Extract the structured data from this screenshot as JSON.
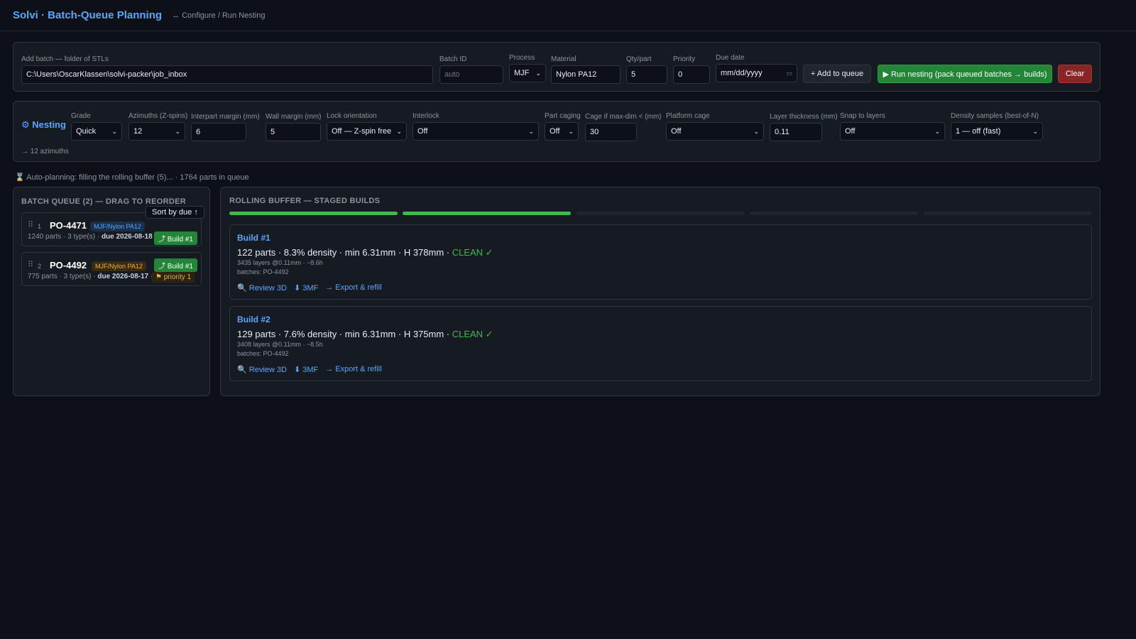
{
  "header": {
    "title": "Solvi · Batch-Queue Planning",
    "breadcrumb": "↔ Configure / Run Nesting"
  },
  "add_batch": {
    "folder_label": "Add batch — folder of STLs",
    "folder_value": "C:\\Users\\OscarKlassen\\solvi-packer\\job_inbox",
    "batch_id_label": "Batch ID",
    "batch_id_placeholder": "auto",
    "process_label": "Process",
    "process_value": "MJF",
    "material_label": "Material",
    "material_value": "Nylon PA12",
    "qty_label": "Qty/part",
    "qty_value": "5",
    "priority_label": "Priority",
    "priority_value": "0",
    "due_label": "Due date",
    "due_placeholder": "mm/dd/yyyy",
    "add_button": "+ Add to queue",
    "run_button": "▶ Run nesting (pack queued batches → builds)",
    "clear_button": "Clear"
  },
  "nesting": {
    "title": "⚙ Nesting",
    "azimuth_note": "→ 12 azimuths",
    "grade": {
      "label": "Grade",
      "value": "Quick"
    },
    "azimuths": {
      "label": "Azimuths (Z-spins)",
      "value": "12"
    },
    "interpart": {
      "label": "Interpart margin (mm)",
      "value": "6"
    },
    "wall": {
      "label": "Wall margin (mm)",
      "value": "5"
    },
    "lock": {
      "label": "Lock orientation",
      "value": "Off — Z-spin free"
    },
    "interlock": {
      "label": "Interlock",
      "value": "Off"
    },
    "caging": {
      "label": "Part caging",
      "value": "Off"
    },
    "cage_if": {
      "label": "Cage if max-dim < (mm)",
      "value": "30"
    },
    "platform": {
      "label": "Platform cage",
      "value": "Off"
    },
    "layer": {
      "label": "Layer thickness (mm)",
      "value": "0.11"
    },
    "snap": {
      "label": "Snap to layers",
      "value": "Off"
    },
    "density": {
      "label": "Density samples (best-of-N)",
      "value": "1 — off (fast)"
    }
  },
  "status": "⌛ Auto-planning: filling the rolling buffer (5)... · 1764 parts in queue",
  "queue": {
    "title": "BATCH QUEUE (2) — DRAG TO REORDER",
    "sort_button": "Sort by due ↑",
    "items": [
      {
        "num": "1",
        "id": "PO-4471",
        "tag": "MJF/Nylon PA12",
        "meta_prefix": "1240 parts · 3 type(s) · ",
        "due": "due 2026-08-18",
        "build": "⤴ Build #1"
      },
      {
        "num": "2",
        "id": "PO-4492",
        "tag": "MJF/Nylon PA12",
        "meta_prefix": "775 parts · 3 type(s) · ",
        "due": "due 2026-08-17",
        "meta_suffix": " ·",
        "build": "⤴ Build #1",
        "priority": "⚑ priority 1"
      }
    ]
  },
  "buffer": {
    "title": "ROLLING BUFFER — STAGED BUILDS",
    "progress_filled": 2,
    "progress_total": 5,
    "builds": [
      {
        "title": "Build #1",
        "summary": "122 parts · 8.3% density · min 6.31mm · H 378mm · ",
        "clean": "CLEAN ✓",
        "layers": "3435 layers @0.11mm · ~8.6h",
        "batches": "batches: PO-4492",
        "review": "🔍 Review 3D",
        "mf": "⬇ 3MF",
        "export": "→ Export & refill"
      },
      {
        "title": "Build #2",
        "summary": "129 parts · 7.6% density · min 6.31mm · H 375mm · ",
        "clean": "CLEAN ✓",
        "layers": "3408 layers @0.11mm · ~8.5h",
        "batches": "batches: PO-4492",
        "review": "🔍 Review 3D",
        "mf": "⬇ 3MF",
        "export": "→ Export & refill"
      }
    ]
  },
  "colors": {
    "background": "#0d1117",
    "panel": "#161b22",
    "accent": "#58a6ff",
    "success": "#238636",
    "danger": "#8a2525"
  }
}
